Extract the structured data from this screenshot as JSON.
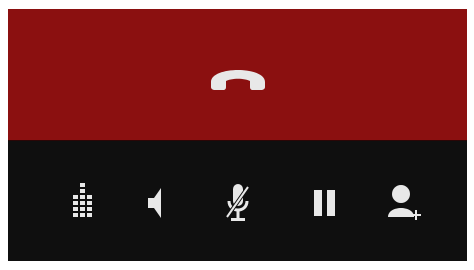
{
  "call_screen": {
    "colors": {
      "end_call_background": "#8b1010",
      "controls_background": "#0f0f0f",
      "icon": "#e8e8e8"
    },
    "end_call": {
      "icon": "phone-hangup-icon"
    },
    "controls": [
      {
        "name": "dialpad",
        "icon": "dialpad-icon"
      },
      {
        "name": "speaker",
        "icon": "speaker-icon"
      },
      {
        "name": "mute",
        "icon": "microphone-mute-icon"
      },
      {
        "name": "hold",
        "icon": "pause-icon"
      },
      {
        "name": "add-call",
        "icon": "add-person-icon"
      }
    ]
  }
}
